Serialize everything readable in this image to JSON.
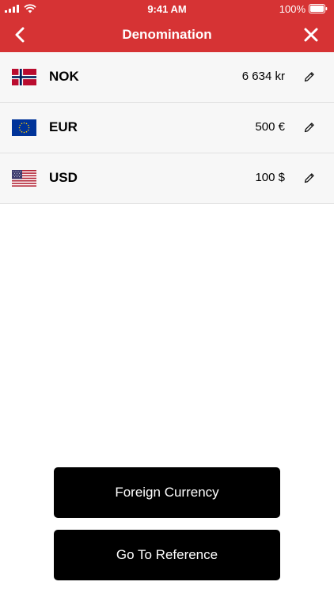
{
  "status_bar": {
    "time": "9:41 AM",
    "battery_percent": "100%",
    "icons": [
      "signal-icon",
      "wifi-icon",
      "battery-icon"
    ]
  },
  "nav": {
    "title": "Denomination",
    "back_icon": "chevron-left-icon",
    "close_icon": "close-icon"
  },
  "currencies": [
    {
      "code": "NOK",
      "amount": "6 634 kr",
      "flag": "norway-flag-icon"
    },
    {
      "code": "EUR",
      "amount": "500 €",
      "flag": "eu-flag-icon"
    },
    {
      "code": "USD",
      "amount": "100 $",
      "flag": "us-flag-icon"
    }
  ],
  "edit_icon": "pencil-icon",
  "buttons": {
    "foreign_currency": "Foreign Currency",
    "go_to_reference": "Go To Reference"
  },
  "colors": {
    "header": "#d63334",
    "row_background": "#f7f7f7",
    "button_background": "#000000",
    "button_text": "#ffffff"
  }
}
